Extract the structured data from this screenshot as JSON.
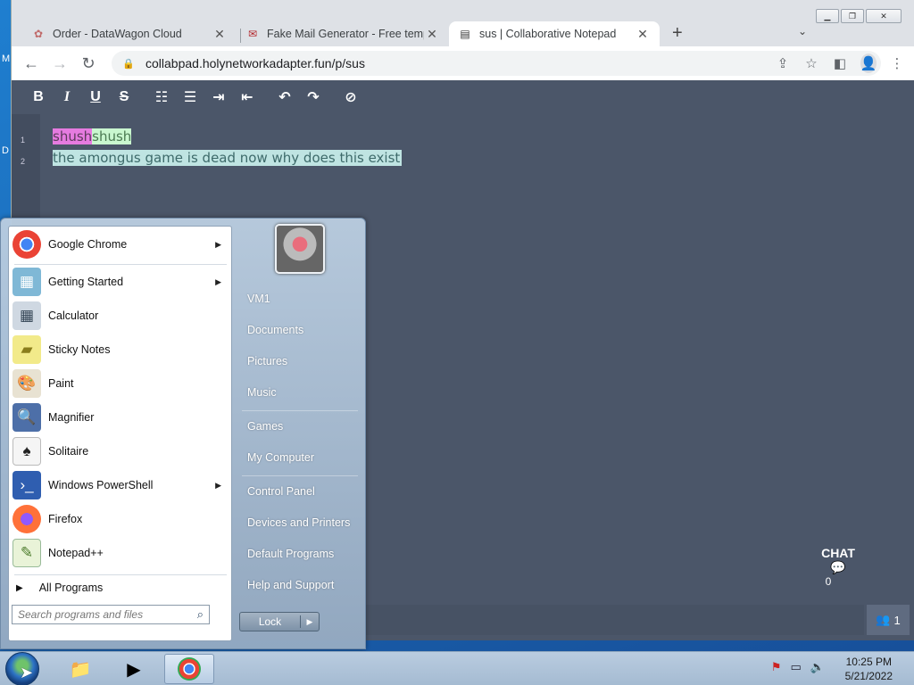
{
  "desktop": {
    "glyphs": [
      "M",
      "D"
    ]
  },
  "browser": {
    "tabs": [
      {
        "title": "Order - DataWagon Cloud",
        "icon": "gear-icon",
        "active": false
      },
      {
        "title": "Fake Mail Generator - Free temp",
        "icon": "mail-icon",
        "active": false
      },
      {
        "title": "sus | Collaborative Notepad",
        "icon": "notepad-icon",
        "active": true
      }
    ],
    "url": "collabpad.holynetworkadapter.fun/p/sus"
  },
  "editor": {
    "lines": [
      {
        "num": "1",
        "parts": [
          "shush",
          "shush"
        ]
      },
      {
        "num": "2",
        "text": "the amongus game is dead now why does this exist"
      }
    ],
    "chat_label": "CHAT",
    "chat_count": "0",
    "users_count": "1"
  },
  "start_menu": {
    "programs": [
      {
        "label": "Google Chrome",
        "icon": "chrome-icon",
        "submenu": true
      },
      {
        "label": "Getting Started",
        "icon": "getting-started-icon",
        "submenu": true
      },
      {
        "label": "Calculator",
        "icon": "calculator-icon",
        "submenu": false
      },
      {
        "label": "Sticky Notes",
        "icon": "sticky-notes-icon",
        "submenu": false
      },
      {
        "label": "Paint",
        "icon": "paint-icon",
        "submenu": false
      },
      {
        "label": "Magnifier",
        "icon": "magnifier-icon",
        "submenu": false
      },
      {
        "label": "Solitaire",
        "icon": "solitaire-icon",
        "submenu": false
      },
      {
        "label": "Windows PowerShell",
        "icon": "powershell-icon",
        "submenu": true
      },
      {
        "label": "Firefox",
        "icon": "firefox-icon",
        "submenu": false
      },
      {
        "label": "Notepad++",
        "icon": "notepadpp-icon",
        "submenu": false
      }
    ],
    "all_programs": "All Programs",
    "search_placeholder": "Search programs and files",
    "right_links": [
      "VM1",
      "Documents",
      "Pictures",
      "Music",
      "Games",
      "My Computer",
      "Control Panel",
      "Devices and Printers",
      "Default Programs",
      "Help and Support"
    ],
    "lock_label": "Lock"
  },
  "taskbar": {
    "time": "10:25 PM",
    "date": "5/21/2022"
  }
}
